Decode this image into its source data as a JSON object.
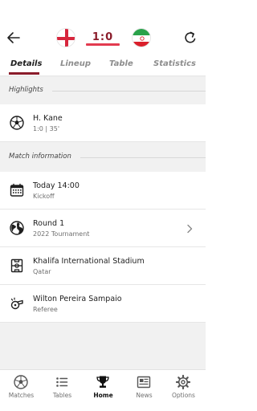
{
  "header": {
    "home_team_flag": "england-flag",
    "away_team_flag": "iran-flag",
    "score": "1:0",
    "back_icon": "arrow-left-icon",
    "refresh_icon": "refresh-icon",
    "accent_color": "#8a1c2b",
    "score_underline_color": "#e23b4f"
  },
  "tabs": [
    {
      "label": "Details",
      "active": true
    },
    {
      "label": "Lineup",
      "active": false
    },
    {
      "label": "Table",
      "active": false
    },
    {
      "label": "Statistics",
      "active": false
    }
  ],
  "highlights": {
    "title": "Highlights",
    "items": [
      {
        "icon": "soccer-ball-icon",
        "title": "H. Kane",
        "subtitle": "1:0 | 35'"
      }
    ]
  },
  "match_info": {
    "title": "Match information",
    "items": [
      {
        "icon": "calendar-icon",
        "title": "Today 14:00",
        "subtitle": "Kickoff"
      },
      {
        "icon": "globe-icon",
        "title": "Round 1",
        "subtitle": "2022 Tournament",
        "chevron": "chevron-right-icon"
      },
      {
        "icon": "stadium-icon",
        "title": "Khalifa International Stadium",
        "subtitle": "Qatar"
      },
      {
        "icon": "whistle-icon",
        "title": "Wilton Pereira Sampaio",
        "subtitle": "Referee"
      }
    ]
  },
  "bottom_nav": [
    {
      "label": "Matches",
      "icon": "soccer-ball-icon",
      "active": false
    },
    {
      "label": "Tables",
      "icon": "list-icon",
      "active": false
    },
    {
      "label": "Home",
      "icon": "trophy-icon",
      "active": true
    },
    {
      "label": "News",
      "icon": "newspaper-icon",
      "active": false
    },
    {
      "label": "Options",
      "icon": "gear-icon",
      "active": false
    }
  ]
}
